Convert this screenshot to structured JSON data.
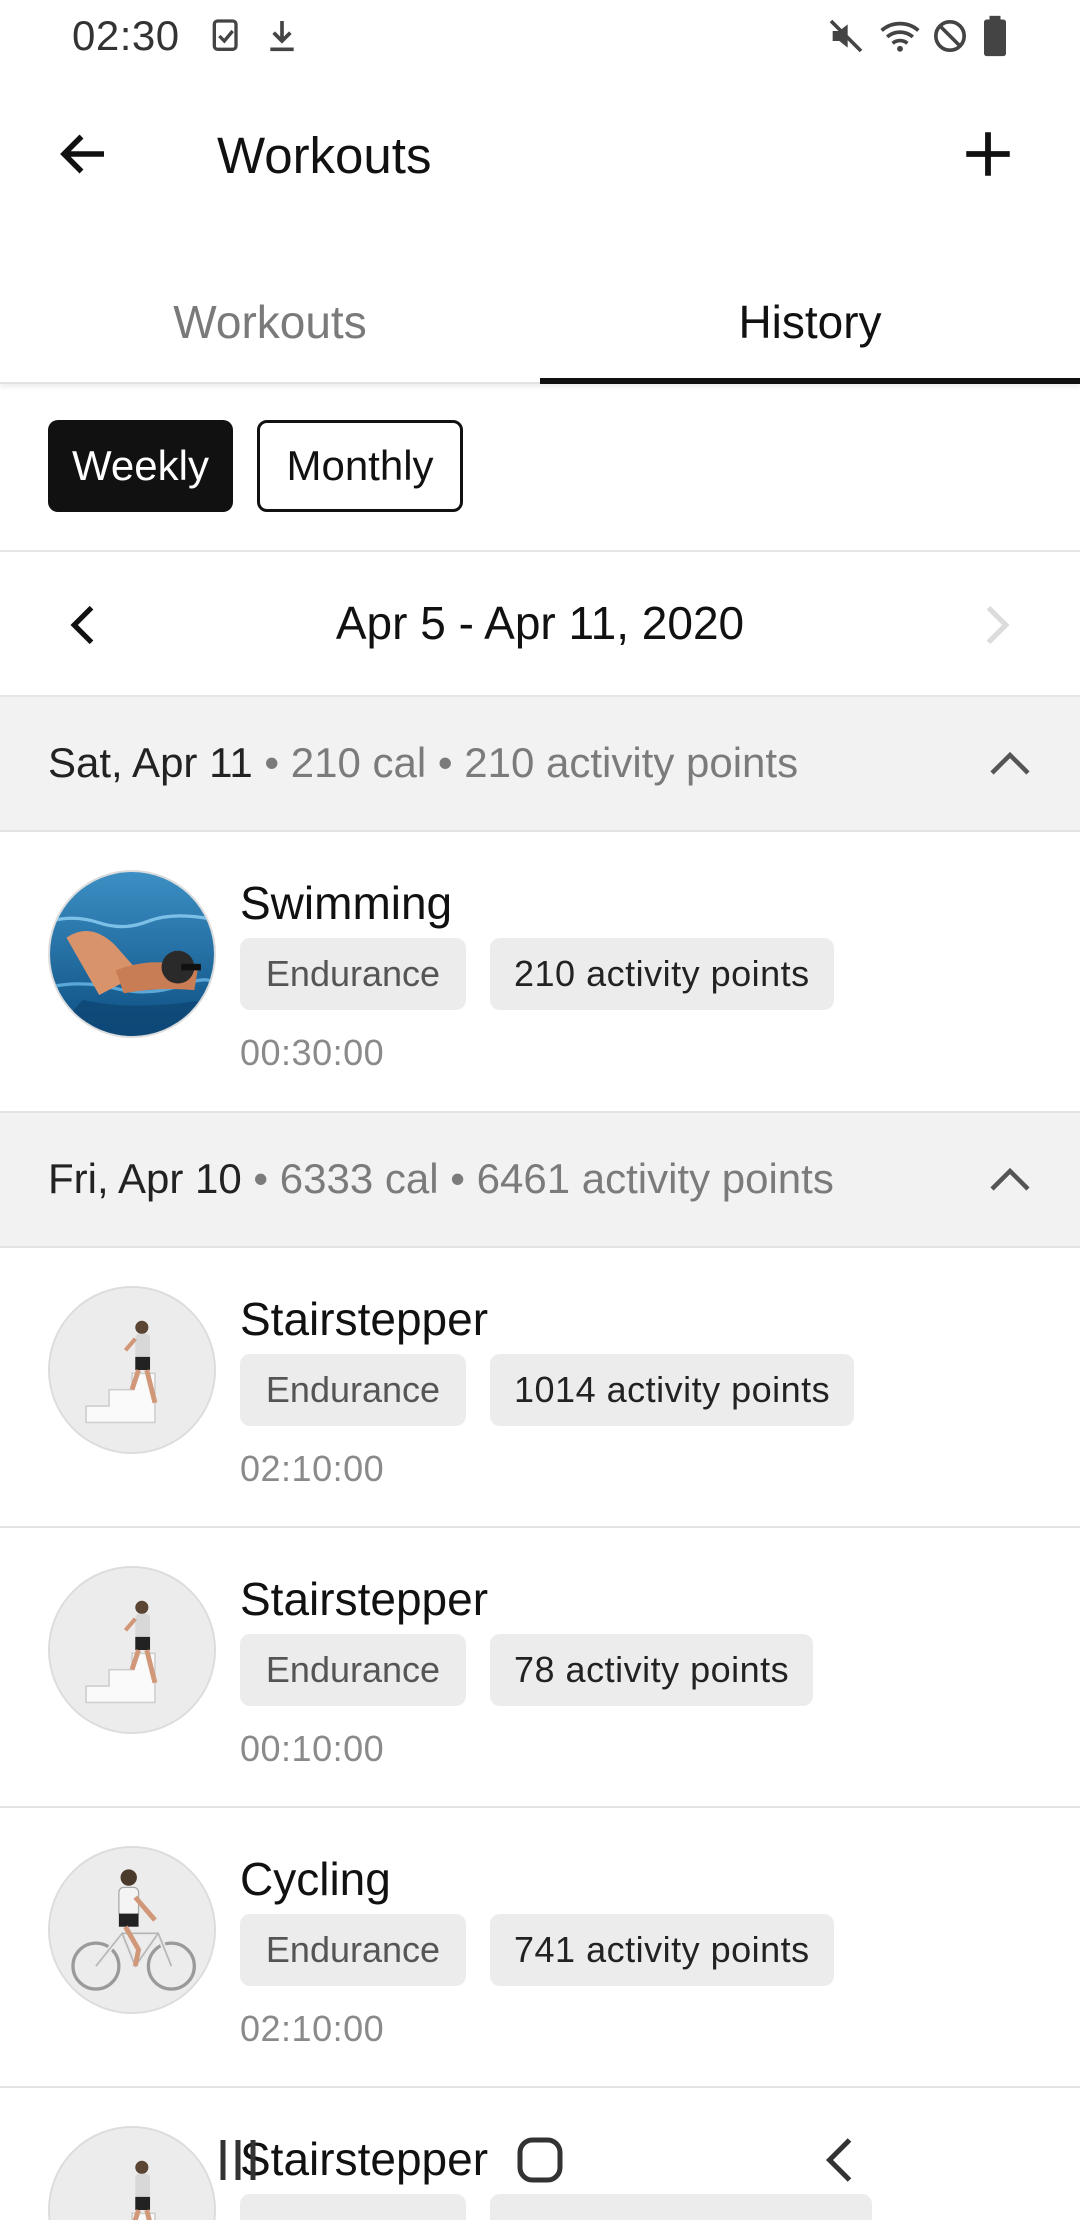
{
  "status_bar": {
    "time": "02:30",
    "left_icons": [
      "task-icon",
      "download-icon"
    ],
    "right_icons": [
      "mute-icon",
      "wifi-icon",
      "blocked-icon",
      "battery-icon"
    ]
  },
  "app_bar": {
    "title": "Workouts",
    "back_icon": "arrow-back-icon",
    "add_icon": "plus-icon"
  },
  "tabs": [
    {
      "label": "Workouts",
      "active": false
    },
    {
      "label": "History",
      "active": true
    }
  ],
  "filter": {
    "options": [
      "Weekly",
      "Monthly"
    ],
    "selected": "Weekly"
  },
  "date_nav": {
    "range": "Apr 5 - Apr 11, 2020"
  },
  "days": [
    {
      "day": "Sat, Apr 11",
      "summary": " • 210 cal • 210 activity points",
      "workouts": [
        {
          "name": "Swimming",
          "type": "Endurance",
          "points": "210 activity points",
          "duration": "00:30:00",
          "image": "swimmer"
        }
      ]
    },
    {
      "day": "Fri, Apr 10",
      "summary": " • 6333 cal • 6461 activity points",
      "workouts": [
        {
          "name": "Stairstepper",
          "type": "Endurance",
          "points": "1014 activity points",
          "duration": "02:10:00",
          "image": "stairstepper"
        },
        {
          "name": "Stairstepper",
          "type": "Endurance",
          "points": "78 activity points",
          "duration": "00:10:00",
          "image": "stairstepper"
        },
        {
          "name": "Cycling",
          "type": "Endurance",
          "points": "741 activity points",
          "duration": "02:10:00",
          "image": "cyclist"
        },
        {
          "name": "Stairstepper",
          "type": "",
          "points": "",
          "duration": "",
          "image": "stairstepper"
        }
      ]
    }
  ],
  "nav_bar": {
    "icons": [
      "recents-icon",
      "home-icon",
      "back-icon"
    ]
  },
  "colors": {
    "accent": "#111111",
    "day_header_bg": "#f2f2f2",
    "tag_bg": "#ececec",
    "muted_text": "#7b7b7b"
  }
}
